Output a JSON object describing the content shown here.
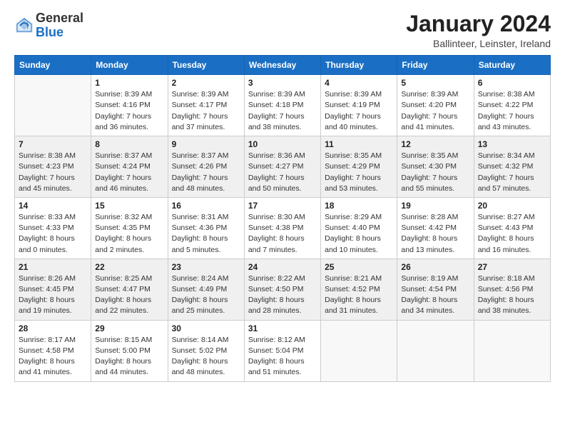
{
  "logo": {
    "general": "General",
    "blue": "Blue"
  },
  "title": "January 2024",
  "location": "Ballinteer, Leinster, Ireland",
  "weekdays": [
    "Sunday",
    "Monday",
    "Tuesday",
    "Wednesday",
    "Thursday",
    "Friday",
    "Saturday"
  ],
  "weeks": [
    [
      {
        "day": "",
        "empty": true
      },
      {
        "day": "1",
        "sunrise": "Sunrise: 8:39 AM",
        "sunset": "Sunset: 4:16 PM",
        "daylight": "Daylight: 7 hours and 36 minutes."
      },
      {
        "day": "2",
        "sunrise": "Sunrise: 8:39 AM",
        "sunset": "Sunset: 4:17 PM",
        "daylight": "Daylight: 7 hours and 37 minutes."
      },
      {
        "day": "3",
        "sunrise": "Sunrise: 8:39 AM",
        "sunset": "Sunset: 4:18 PM",
        "daylight": "Daylight: 7 hours and 38 minutes."
      },
      {
        "day": "4",
        "sunrise": "Sunrise: 8:39 AM",
        "sunset": "Sunset: 4:19 PM",
        "daylight": "Daylight: 7 hours and 40 minutes."
      },
      {
        "day": "5",
        "sunrise": "Sunrise: 8:39 AM",
        "sunset": "Sunset: 4:20 PM",
        "daylight": "Daylight: 7 hours and 41 minutes."
      },
      {
        "day": "6",
        "sunrise": "Sunrise: 8:38 AM",
        "sunset": "Sunset: 4:22 PM",
        "daylight": "Daylight: 7 hours and 43 minutes."
      }
    ],
    [
      {
        "day": "7",
        "sunrise": "Sunrise: 8:38 AM",
        "sunset": "Sunset: 4:23 PM",
        "daylight": "Daylight: 7 hours and 45 minutes."
      },
      {
        "day": "8",
        "sunrise": "Sunrise: 8:37 AM",
        "sunset": "Sunset: 4:24 PM",
        "daylight": "Daylight: 7 hours and 46 minutes."
      },
      {
        "day": "9",
        "sunrise": "Sunrise: 8:37 AM",
        "sunset": "Sunset: 4:26 PM",
        "daylight": "Daylight: 7 hours and 48 minutes."
      },
      {
        "day": "10",
        "sunrise": "Sunrise: 8:36 AM",
        "sunset": "Sunset: 4:27 PM",
        "daylight": "Daylight: 7 hours and 50 minutes."
      },
      {
        "day": "11",
        "sunrise": "Sunrise: 8:35 AM",
        "sunset": "Sunset: 4:29 PM",
        "daylight": "Daylight: 7 hours and 53 minutes."
      },
      {
        "day": "12",
        "sunrise": "Sunrise: 8:35 AM",
        "sunset": "Sunset: 4:30 PM",
        "daylight": "Daylight: 7 hours and 55 minutes."
      },
      {
        "day": "13",
        "sunrise": "Sunrise: 8:34 AM",
        "sunset": "Sunset: 4:32 PM",
        "daylight": "Daylight: 7 hours and 57 minutes."
      }
    ],
    [
      {
        "day": "14",
        "sunrise": "Sunrise: 8:33 AM",
        "sunset": "Sunset: 4:33 PM",
        "daylight": "Daylight: 8 hours and 0 minutes."
      },
      {
        "day": "15",
        "sunrise": "Sunrise: 8:32 AM",
        "sunset": "Sunset: 4:35 PM",
        "daylight": "Daylight: 8 hours and 2 minutes."
      },
      {
        "day": "16",
        "sunrise": "Sunrise: 8:31 AM",
        "sunset": "Sunset: 4:36 PM",
        "daylight": "Daylight: 8 hours and 5 minutes."
      },
      {
        "day": "17",
        "sunrise": "Sunrise: 8:30 AM",
        "sunset": "Sunset: 4:38 PM",
        "daylight": "Daylight: 8 hours and 7 minutes."
      },
      {
        "day": "18",
        "sunrise": "Sunrise: 8:29 AM",
        "sunset": "Sunset: 4:40 PM",
        "daylight": "Daylight: 8 hours and 10 minutes."
      },
      {
        "day": "19",
        "sunrise": "Sunrise: 8:28 AM",
        "sunset": "Sunset: 4:42 PM",
        "daylight": "Daylight: 8 hours and 13 minutes."
      },
      {
        "day": "20",
        "sunrise": "Sunrise: 8:27 AM",
        "sunset": "Sunset: 4:43 PM",
        "daylight": "Daylight: 8 hours and 16 minutes."
      }
    ],
    [
      {
        "day": "21",
        "sunrise": "Sunrise: 8:26 AM",
        "sunset": "Sunset: 4:45 PM",
        "daylight": "Daylight: 8 hours and 19 minutes."
      },
      {
        "day": "22",
        "sunrise": "Sunrise: 8:25 AM",
        "sunset": "Sunset: 4:47 PM",
        "daylight": "Daylight: 8 hours and 22 minutes."
      },
      {
        "day": "23",
        "sunrise": "Sunrise: 8:24 AM",
        "sunset": "Sunset: 4:49 PM",
        "daylight": "Daylight: 8 hours and 25 minutes."
      },
      {
        "day": "24",
        "sunrise": "Sunrise: 8:22 AM",
        "sunset": "Sunset: 4:50 PM",
        "daylight": "Daylight: 8 hours and 28 minutes."
      },
      {
        "day": "25",
        "sunrise": "Sunrise: 8:21 AM",
        "sunset": "Sunset: 4:52 PM",
        "daylight": "Daylight: 8 hours and 31 minutes."
      },
      {
        "day": "26",
        "sunrise": "Sunrise: 8:19 AM",
        "sunset": "Sunset: 4:54 PM",
        "daylight": "Daylight: 8 hours and 34 minutes."
      },
      {
        "day": "27",
        "sunrise": "Sunrise: 8:18 AM",
        "sunset": "Sunset: 4:56 PM",
        "daylight": "Daylight: 8 hours and 38 minutes."
      }
    ],
    [
      {
        "day": "28",
        "sunrise": "Sunrise: 8:17 AM",
        "sunset": "Sunset: 4:58 PM",
        "daylight": "Daylight: 8 hours and 41 minutes."
      },
      {
        "day": "29",
        "sunrise": "Sunrise: 8:15 AM",
        "sunset": "Sunset: 5:00 PM",
        "daylight": "Daylight: 8 hours and 44 minutes."
      },
      {
        "day": "30",
        "sunrise": "Sunrise: 8:14 AM",
        "sunset": "Sunset: 5:02 PM",
        "daylight": "Daylight: 8 hours and 48 minutes."
      },
      {
        "day": "31",
        "sunrise": "Sunrise: 8:12 AM",
        "sunset": "Sunset: 5:04 PM",
        "daylight": "Daylight: 8 hours and 51 minutes."
      },
      {
        "day": "",
        "empty": true
      },
      {
        "day": "",
        "empty": true
      },
      {
        "day": "",
        "empty": true
      }
    ]
  ]
}
